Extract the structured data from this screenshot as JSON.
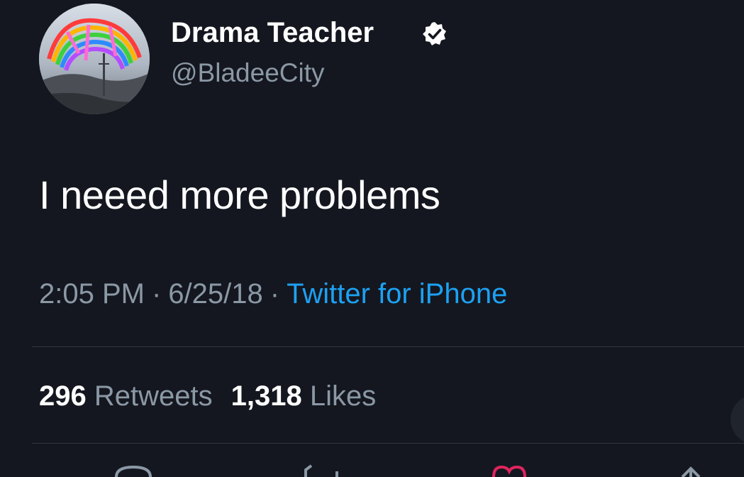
{
  "user": {
    "display_name": "Drama Teacher",
    "handle": "@BladeeCity",
    "verified": true
  },
  "tweet": {
    "text": "I neeed more problems",
    "time": "2:05 PM",
    "date": "6/25/18",
    "separator": "·",
    "source": "Twitter for iPhone"
  },
  "stats": {
    "retweets_count": "296",
    "retweets_label": "Retweets",
    "likes_count": "1,318",
    "likes_label": "Likes"
  },
  "actions": {
    "icons": [
      "reply-icon",
      "retweet-icon",
      "like-icon",
      "share-icon"
    ]
  },
  "colors": {
    "background": "#14171f",
    "text_primary": "#ffffff",
    "text_secondary": "#8b98a5",
    "link": "#1da1f2",
    "divider": "#2f3742",
    "like": "#e0245e"
  }
}
